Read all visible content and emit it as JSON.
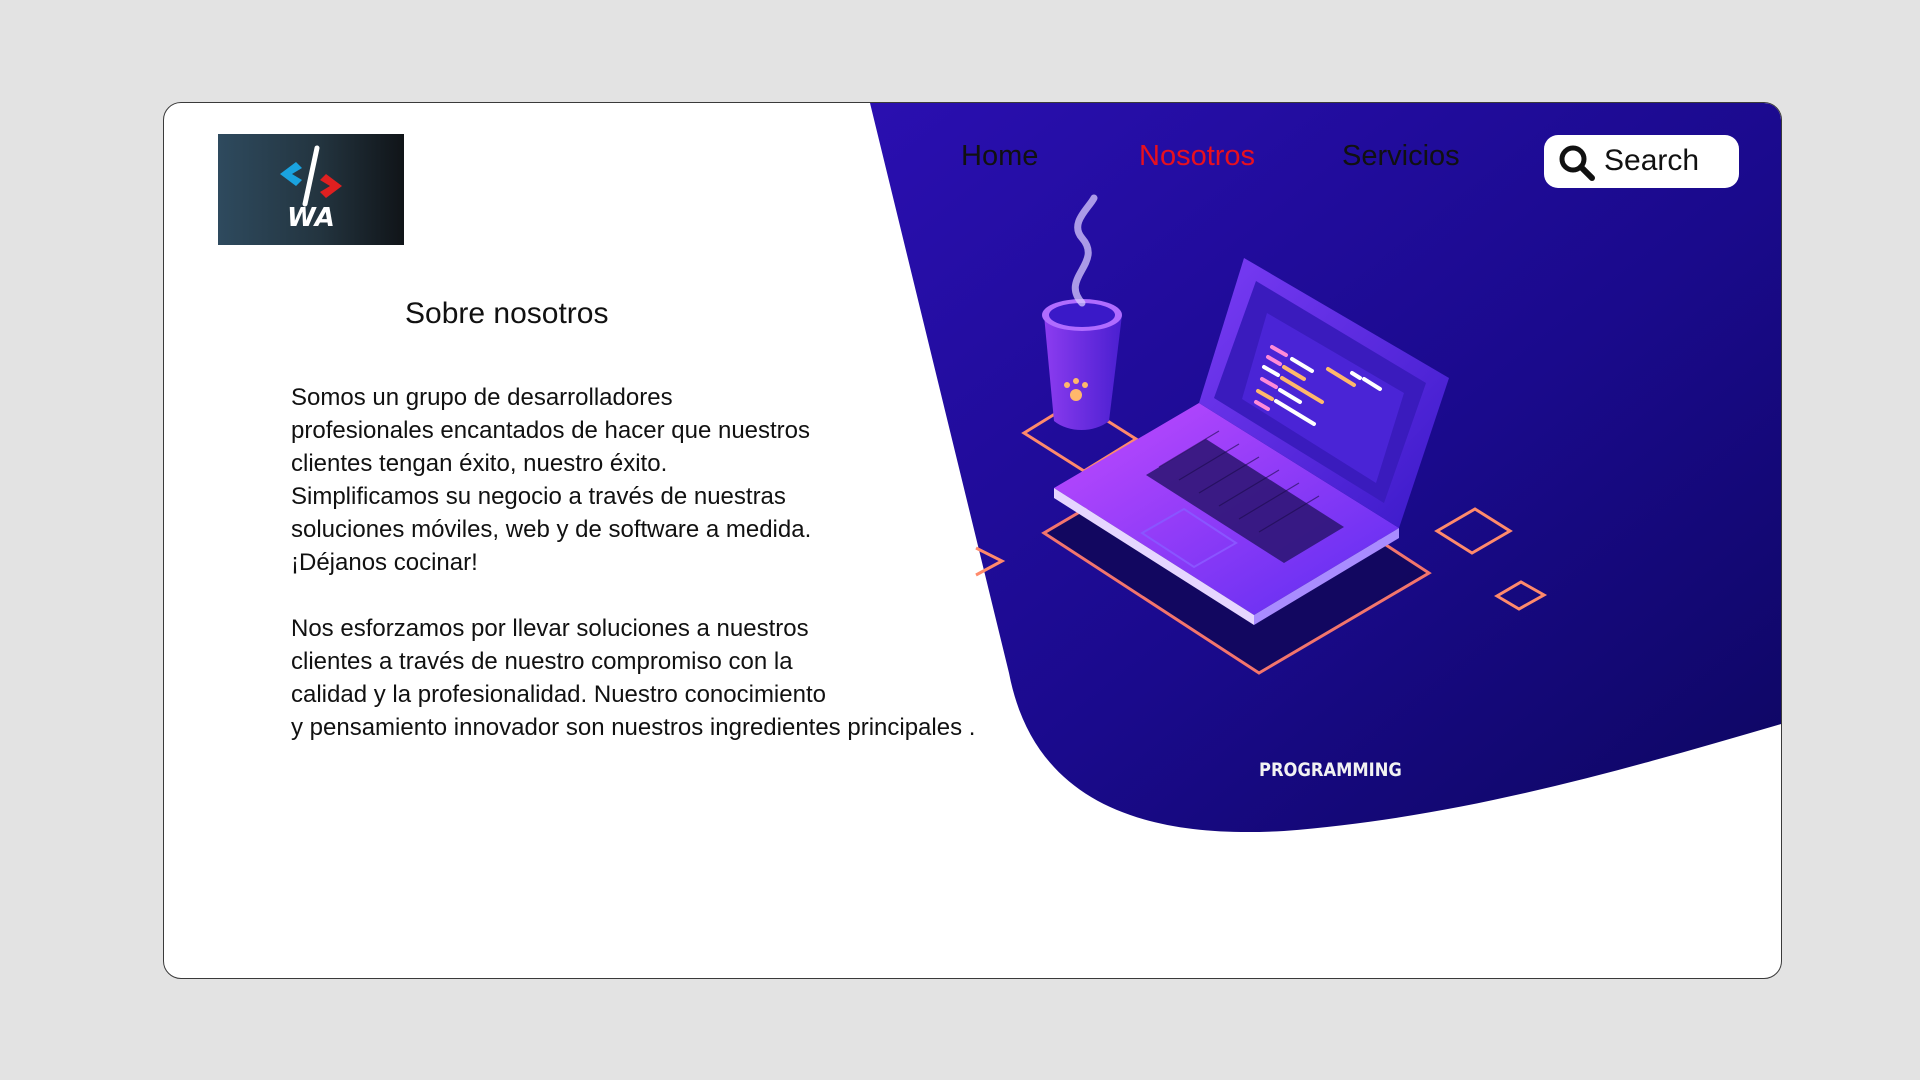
{
  "brand": {
    "logo_text": "WA",
    "logo_colors": {
      "chevron_left": "#1aa3e0",
      "chevron_right": "#e02020",
      "slash": "#ffffff"
    }
  },
  "nav": {
    "items": [
      {
        "label": "Home",
        "active": false
      },
      {
        "label": "Nosotros",
        "active": true
      },
      {
        "label": "Servicios",
        "active": false
      }
    ],
    "active_color": "#e8101e"
  },
  "search": {
    "label": "Search",
    "icon": "search-icon"
  },
  "about": {
    "title": "Sobre nosotros",
    "paragraph1": [
      "Somos un grupo de desarrolladores",
      "profesionales encantados de hacer que nuestros",
      "clientes tengan éxito, nuestro éxito.",
      "Simplificamos su negocio a través de nuestras",
      "soluciones móviles, web y de software a medida.",
      "¡Déjanos cocinar!"
    ],
    "paragraph2": [
      "Nos esforzamos por llevar soluciones a nuestros",
      "clientes a través de nuestro compromiso con la",
      "calidad y la profesionalidad. Nuestro conocimiento",
      "y pensamiento innovador son nuestros ingredientes principales ."
    ]
  },
  "hero": {
    "caption": "PROGRAMMING",
    "background_color": "#1c0a8a",
    "accent_color": "#ff7b6b"
  }
}
